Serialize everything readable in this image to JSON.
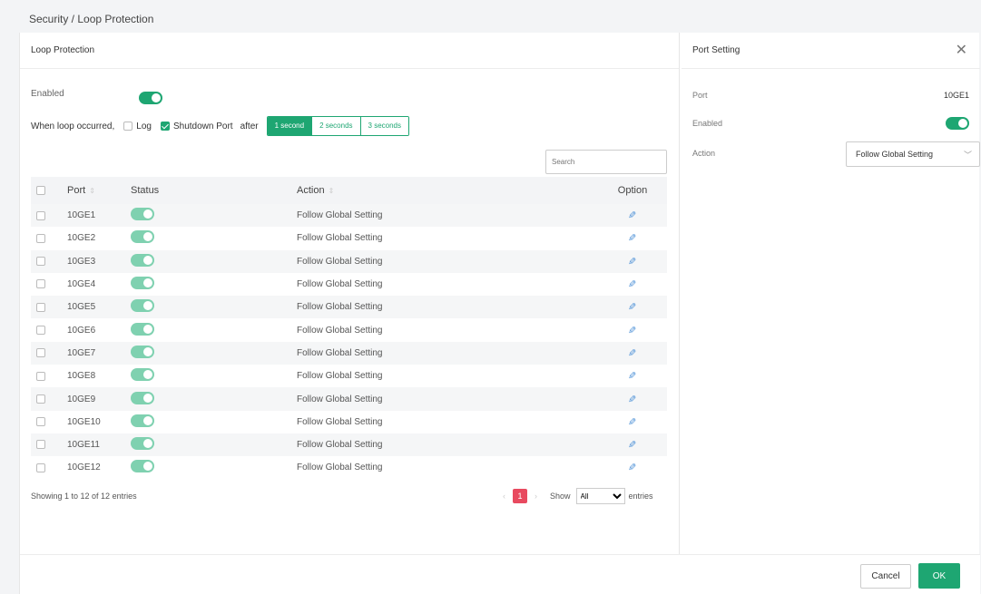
{
  "breadcrumb": "Security / Loop Protection",
  "main": {
    "title": "Loop Protection",
    "enabled_label": "Enabled",
    "enabled": true,
    "loop_label": "When loop occurred,",
    "log_label": "Log",
    "log_checked": false,
    "shutdown_label": "Shutdown Port",
    "shutdown_checked": true,
    "after_label": "after",
    "durations": [
      "1 second",
      "2 seconds",
      "3 seconds"
    ],
    "selected_duration": "1 second",
    "search_placeholder": "Search"
  },
  "table": {
    "headers": {
      "port": "Port",
      "status": "Status",
      "action": "Action",
      "option": "Option"
    },
    "rows": [
      {
        "port": "10GE1",
        "status": true,
        "action": "Follow Global Setting"
      },
      {
        "port": "10GE2",
        "status": true,
        "action": "Follow Global Setting"
      },
      {
        "port": "10GE3",
        "status": true,
        "action": "Follow Global Setting"
      },
      {
        "port": "10GE4",
        "status": true,
        "action": "Follow Global Setting"
      },
      {
        "port": "10GE5",
        "status": true,
        "action": "Follow Global Setting"
      },
      {
        "port": "10GE6",
        "status": true,
        "action": "Follow Global Setting"
      },
      {
        "port": "10GE7",
        "status": true,
        "action": "Follow Global Setting"
      },
      {
        "port": "10GE8",
        "status": true,
        "action": "Follow Global Setting"
      },
      {
        "port": "10GE9",
        "status": true,
        "action": "Follow Global Setting"
      },
      {
        "port": "10GE10",
        "status": true,
        "action": "Follow Global Setting"
      },
      {
        "port": "10GE11",
        "status": true,
        "action": "Follow Global Setting"
      },
      {
        "port": "10GE12",
        "status": true,
        "action": "Follow Global Setting"
      }
    ]
  },
  "footer": {
    "showing": "Showing 1 to 12 of 12 entries",
    "current_page": "1",
    "show_label": "Show",
    "page_size": "All",
    "entries_label": "entries"
  },
  "port_setting": {
    "title": "Port Setting",
    "port_label": "Port",
    "port_value": "10GE1",
    "enabled_label": "Enabled",
    "enabled": true,
    "action_label": "Action",
    "action_value": "Follow Global Setting"
  },
  "buttons": {
    "cancel": "Cancel",
    "ok": "OK"
  },
  "colors": {
    "accent": "#1ea672",
    "page_active": "#e84a5f",
    "edit_icon": "#4a8fd6"
  }
}
